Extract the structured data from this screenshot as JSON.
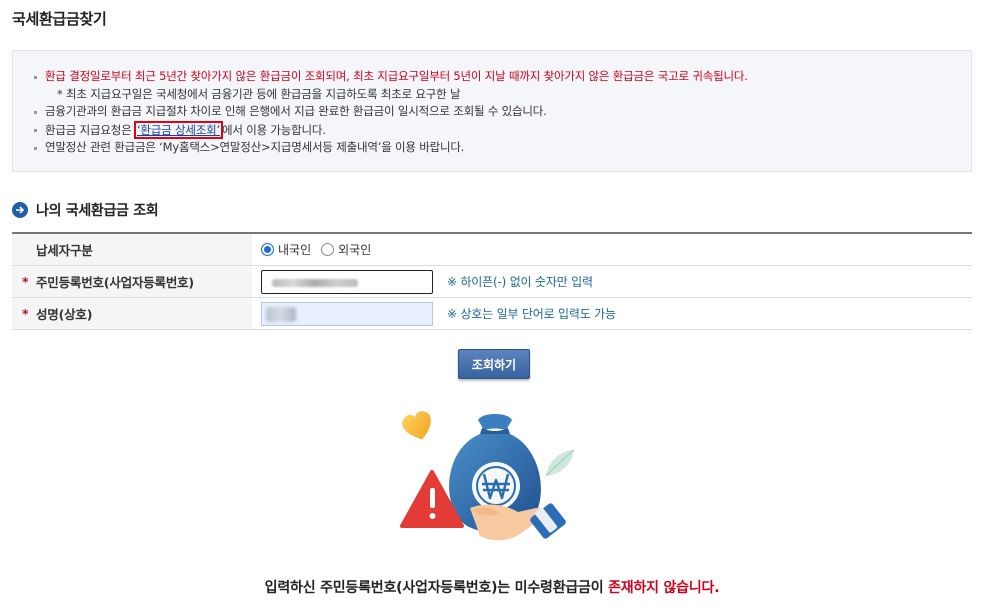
{
  "page": {
    "title": "국세환급금찾기"
  },
  "notice": {
    "items": [
      {
        "text": "환급 결정일로부터 최근 5년간 찾아가지 않은 환급금이 조회되며, 최초 지급요구일부터 5년이 지날 때까지 찾아가지 않은 환급금은 국고로 귀속됩니다.",
        "style": "red"
      },
      {
        "text": "* 최초 지급요구일은 국세청에서 금융기관 등에 환급금을 지급하도록 최초로 요구한 날",
        "style": "sub"
      },
      {
        "text": "금융기관과의 환급금 지급절차 차이로 인해 은행에서 지급 완료한 환급금이 일시적으로 조회될 수 있습니다.",
        "style": "normal"
      },
      {
        "text": "연말정산 관련 환급금은 ‘My홈택스>연말정산>지급명세서등 제출내역’을 이용 바랍니다.",
        "style": "normal"
      }
    ],
    "link_item": {
      "prefix": "환급금 지급요청은 ",
      "link_text": "‘환급금 상세조회’",
      "suffix": "에서 이용 가능합니다."
    }
  },
  "section": {
    "title": "나의 국세환급금 조회"
  },
  "form": {
    "taxpayer_type_label": "납세자구분",
    "options": [
      {
        "label": "내국인",
        "selected": true
      },
      {
        "label": "외국인",
        "selected": false
      }
    ],
    "required_mark": "*",
    "id_label": "주민등록번호(사업자등록번호)",
    "id_hint": "※ 하이픈(-) 없이 숫자만 입력",
    "name_label": "성명(상호)",
    "name_hint": "※ 상호는 일부 단어로 입력도 가능"
  },
  "search_button": {
    "label": "조회하기"
  },
  "result": {
    "text_before": "입력하신 주민등록번호(사업자등록번호)는 미수령환급금이 ",
    "text_emphasis": "존재하지 않습니다."
  },
  "colors": {
    "accent": "#1d5fa8",
    "warning": "#d0021b",
    "button": "#3f6aa6"
  }
}
